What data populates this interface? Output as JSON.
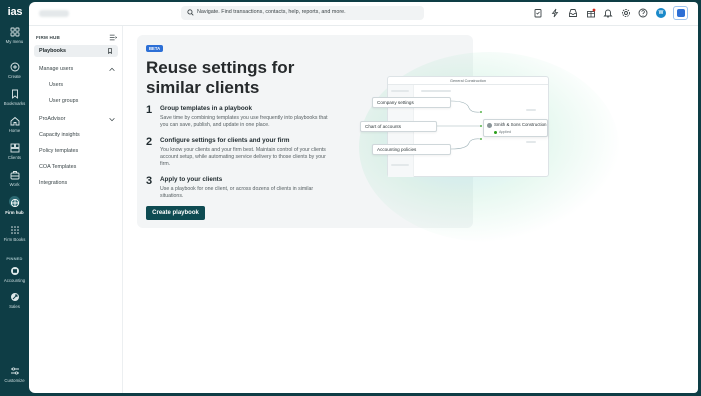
{
  "rail": {
    "logo": "ias",
    "items": [
      {
        "label": "My menu",
        "icon": "grid-icon"
      },
      {
        "label": "Create",
        "icon": "plus-circle-icon"
      },
      {
        "label": "Bookmarks",
        "icon": "bookmark-icon"
      },
      {
        "label": "Home",
        "icon": "home-icon"
      },
      {
        "label": "Clients",
        "icon": "clients-icon"
      },
      {
        "label": "Work",
        "icon": "briefcase-icon"
      },
      {
        "label": "Firm hub",
        "icon": "firm-hub-icon"
      },
      {
        "label": "Firm Books",
        "icon": "dots-grid-icon"
      },
      {
        "label": "Accounting",
        "icon": "accounting-icon"
      },
      {
        "label": "Sales",
        "icon": "sales-icon"
      },
      {
        "label": "Customize",
        "icon": "sliders-icon"
      }
    ],
    "pinned_label": "PINNED"
  },
  "topbar": {
    "search_placeholder": "Navigate. Find transactions, contacts, help, reports, and more.",
    "avatar_initial": "W"
  },
  "sidebar": {
    "heading": "FIRM HUB",
    "items": {
      "playbooks": "Playbooks",
      "manage_users": "Manage users",
      "users": "Users",
      "user_groups": "User groups",
      "proadvisor": "ProAdvisor",
      "capacity_insights": "Capacity insights",
      "policy_templates": "Policy templates",
      "coa_templates": "COA Templates",
      "integrations": "Integrations"
    }
  },
  "main": {
    "badge": "BETA",
    "title": "Reuse settings for similar clients",
    "steps": [
      {
        "num": "1",
        "heading": "Group templates in a playbook",
        "desc": "Save time by combining templates you use frequently into playbooks that you can save, publish, and update in one place."
      },
      {
        "num": "2",
        "heading": "Configure settings for clients and your firm",
        "desc": "You know your clients and your firm best. Maintain control of your clients account setup, while automating service delivery to those clients by your firm."
      },
      {
        "num": "3",
        "heading": "Apply to your clients",
        "desc": "Use a playbook for one client, or across dozens of clients in similar situations."
      }
    ],
    "cta": "Create playbook"
  },
  "illustration": {
    "panel_title": "General Construction",
    "pills": [
      "Company settings",
      "Chart of accounts",
      "Accounting policies"
    ],
    "client_name": "Smith & Sons Construction",
    "client_status": "Applied"
  },
  "colors": {
    "brand_dark": "#0e3d45",
    "cta": "#0e4b52",
    "beta": "#2c6fd6",
    "avatar": "#1a89c9"
  }
}
